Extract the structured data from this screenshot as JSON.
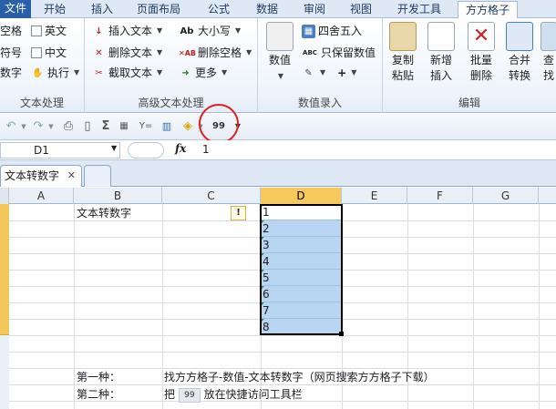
{
  "tabs": [
    "文件",
    "开始",
    "插入",
    "页面布局",
    "公式",
    "数据",
    "审阅",
    "视图",
    "开发工具",
    "方方格子"
  ],
  "active_tab": "方方格子",
  "ribbon": {
    "text_group": {
      "items": [
        "空格",
        "英文",
        "符号",
        "中文",
        "数字",
        "执行"
      ],
      "label": "文本处理"
    },
    "adv_text_group": {
      "items": [
        "插入文本",
        "删除文本",
        "截取文本",
        "大小写",
        "删除空格",
        "更多"
      ],
      "label": "高级文本处理"
    },
    "numeric_group": {
      "big": "数值",
      "items": [
        "四舍五入",
        "只保留数值"
      ],
      "label": "数值录入"
    },
    "edit_group": {
      "buttons": [
        {
          "line1": "复制",
          "line2": "粘贴"
        },
        {
          "line1": "新增",
          "line2": "插入"
        },
        {
          "line1": "批量",
          "line2": "删除"
        },
        {
          "line1": "合并",
          "line2": "转换"
        },
        {
          "line1": "查",
          "line2": "找"
        }
      ],
      "label": "编辑"
    }
  },
  "qat": {
    "custom_icon_text": "99"
  },
  "formula_bar": {
    "name_box": "D1",
    "fx": "fx",
    "value": "1"
  },
  "sheet_tab": {
    "name": "文本转数字",
    "close": "✕"
  },
  "columns": [
    "A",
    "B",
    "C",
    "D",
    "E",
    "F",
    "G"
  ],
  "cells": {
    "b1": "文本转数字",
    "d_values": [
      "1",
      "2",
      "3",
      "4",
      "5",
      "6",
      "7",
      "8"
    ],
    "warn_symbol": "!"
  },
  "notes": {
    "line1_label": "第一种：",
    "line1_text": "找方方格子-数值-文本转数字（网页搜索方方格子下载）",
    "line2_label": "第二种：",
    "line2_pre": "把",
    "line2_icon": "99",
    "line2_post": "放在快捷访问工具栏"
  }
}
